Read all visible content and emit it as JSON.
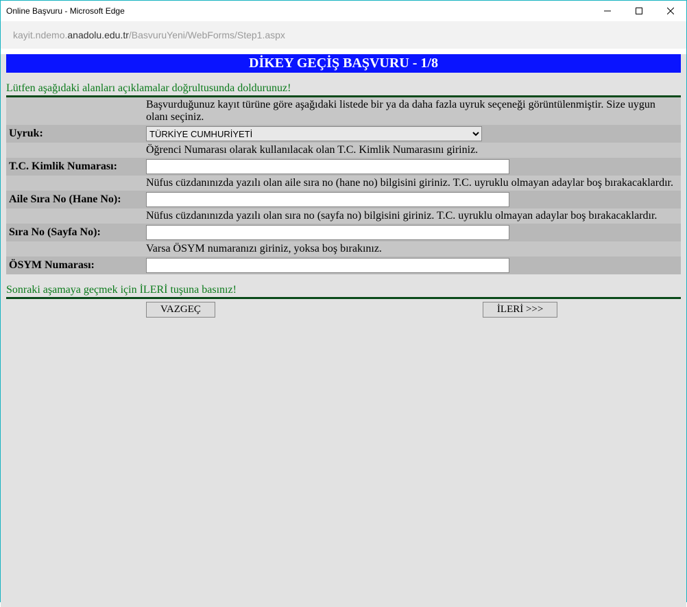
{
  "window": {
    "title": "Online Başvuru - Microsoft Edge"
  },
  "address": {
    "prefix": "kayit.ndemo.",
    "strong": "anadolu.edu.tr",
    "suffix": "/BasvuruYeni/WebForms/Step1.aspx"
  },
  "banner": "DİKEY GEÇİŞ BAŞVURU - 1/8",
  "heading1": "Lütfen aşağıdaki alanları açıklamalar doğrultusunda doldurunuz!",
  "rows": {
    "uyruk": {
      "desc": "Başvurduğunuz kayıt türüne göre aşağıdaki listede bir ya da daha fazla uyruk seçeneği görüntülenmiştir. Size uygun olanı seçiniz.",
      "label": "Uyruk:",
      "options": [
        "TÜRKİYE CUMHURİYETİ"
      ],
      "selected": "TÜRKİYE CUMHURİYETİ"
    },
    "tckn": {
      "desc": "Öğrenci Numarası olarak kullanılacak olan T.C. Kimlik Numarasını giriniz.",
      "label": "T.C. Kimlik Numarası:",
      "value": ""
    },
    "hane": {
      "desc": "Nüfus cüzdanınızda yazılı olan aile sıra no (hane no) bilgisini giriniz. T.C. uyruklu olmayan adaylar boş bırakacaklardır.",
      "label": "Aile Sıra No (Hane No):",
      "value": ""
    },
    "sira": {
      "desc": "Nüfus cüzdanınızda yazılı olan sıra no (sayfa no) bilgisini giriniz. T.C. uyruklu olmayan adaylar boş bırakacaklardır.",
      "label": "Sıra No (Sayfa No):",
      "value": ""
    },
    "osym": {
      "desc": "Varsa ÖSYM numaranızı giriniz, yoksa boş bırakınız.",
      "label": "ÖSYM Numarası:",
      "value": ""
    }
  },
  "heading2": "Sonraki aşamaya geçmek için İLERİ tuşuna basınız!",
  "buttons": {
    "cancel": "VAZGEÇ",
    "next": "İLERİ >>>"
  }
}
